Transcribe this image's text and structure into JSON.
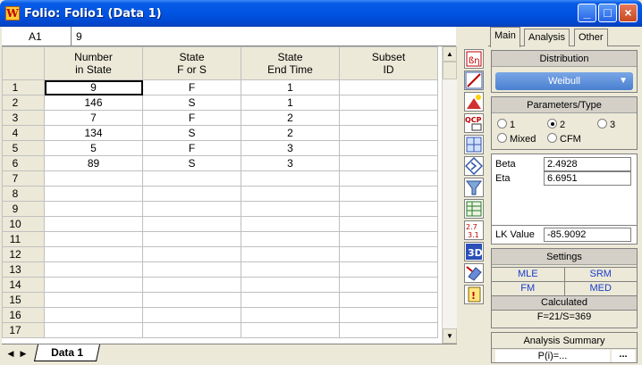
{
  "window": {
    "title": "Folio: Folio1 (Data 1)",
    "buttons": {
      "minimize": "_",
      "maximize": "□",
      "close": "×"
    }
  },
  "formula_bar": {
    "cell_ref": "A1",
    "value": "9"
  },
  "grid": {
    "columns": [
      {
        "line1": "Number",
        "line2": "in State"
      },
      {
        "line1": "State",
        "line2": "F or S"
      },
      {
        "line1": "State",
        "line2": "End Time"
      },
      {
        "line1": "Subset",
        "line2": "ID"
      }
    ],
    "rows": [
      {
        "num": "1",
        "cells": [
          "9",
          "F",
          "1",
          ""
        ]
      },
      {
        "num": "2",
        "cells": [
          "146",
          "S",
          "1",
          ""
        ]
      },
      {
        "num": "3",
        "cells": [
          "7",
          "F",
          "2",
          ""
        ]
      },
      {
        "num": "4",
        "cells": [
          "134",
          "S",
          "2",
          ""
        ]
      },
      {
        "num": "5",
        "cells": [
          "5",
          "F",
          "3",
          ""
        ]
      },
      {
        "num": "6",
        "cells": [
          "89",
          "S",
          "3",
          ""
        ]
      },
      {
        "num": "7",
        "cells": [
          "",
          "",
          "",
          ""
        ]
      },
      {
        "num": "8",
        "cells": [
          "",
          "",
          "",
          ""
        ]
      },
      {
        "num": "9",
        "cells": [
          "",
          "",
          "",
          ""
        ]
      },
      {
        "num": "10",
        "cells": [
          "",
          "",
          "",
          ""
        ]
      },
      {
        "num": "11",
        "cells": [
          "",
          "",
          "",
          ""
        ]
      },
      {
        "num": "12",
        "cells": [
          "",
          "",
          "",
          ""
        ]
      },
      {
        "num": "13",
        "cells": [
          "",
          "",
          "",
          ""
        ]
      },
      {
        "num": "14",
        "cells": [
          "",
          "",
          "",
          ""
        ]
      },
      {
        "num": "15",
        "cells": [
          "",
          "",
          "",
          ""
        ]
      },
      {
        "num": "16",
        "cells": [
          "",
          "",
          "",
          ""
        ]
      },
      {
        "num": "17",
        "cells": [
          "",
          "",
          "",
          ""
        ]
      }
    ]
  },
  "sheet_tabs": {
    "active": "Data 1"
  },
  "panel": {
    "tabs": [
      "Main",
      "Analysis",
      "Other"
    ],
    "distribution": {
      "title": "Distribution",
      "value": "Weibull"
    },
    "parameters": {
      "title": "Parameters/Type",
      "options": [
        "1",
        "2",
        "3",
        "Mixed",
        "CFM"
      ],
      "selected": "2"
    },
    "beta": {
      "label": "Beta",
      "value": "2.4928"
    },
    "eta": {
      "label": "Eta",
      "value": "6.6951"
    },
    "lk": {
      "label": "LK Value",
      "value": "-85.9092"
    },
    "settings": {
      "title": "Settings",
      "items": [
        "MLE",
        "SRM",
        "FM",
        "MED"
      ],
      "calculated_label": "Calculated",
      "calculated_value": "F=21/S=369"
    },
    "analysis_summary": {
      "title": "Analysis Summary",
      "value": "P(i)=...",
      "more": "..."
    }
  },
  "colors": {
    "titlebar": "#0054e3",
    "link_blue": "#1a3cc8",
    "dropdown": "#4a7fd0"
  }
}
